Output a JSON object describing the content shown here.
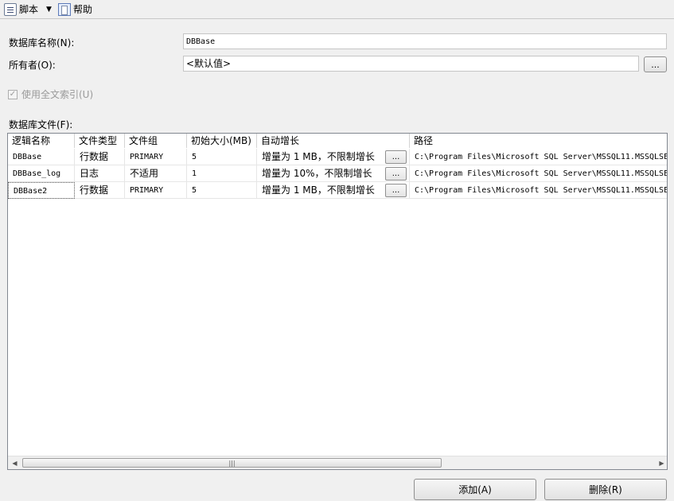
{
  "toolbar": {
    "script": {
      "label": "脚本",
      "icon": "script-icon"
    },
    "help": {
      "label": "帮助",
      "icon": "help-icon"
    }
  },
  "form": {
    "database_name_label": "数据库名称(N):",
    "database_name_value": "DBBase",
    "owner_label": "所有者(O):",
    "owner_value": "<默认值>",
    "fulltext_label": "使用全文索引(U)",
    "fulltext_checked": true,
    "files_label": "数据库文件(F):",
    "ellipsis": "..."
  },
  "grid": {
    "headers": [
      "逻辑名称",
      "文件类型",
      "文件组",
      "初始大小(MB)",
      "自动增长",
      "路径"
    ],
    "rows": [
      {
        "logical_name": "DBBase",
        "file_type": "行数据",
        "filegroup": "PRIMARY",
        "initial_size": "5",
        "autogrowth": "增量为 1 MB，不限制增长",
        "path": "C:\\Program Files\\Microsoft SQL Server\\MSSQL11.MSSQLSE"
      },
      {
        "logical_name": "DBBase_log",
        "file_type": "日志",
        "filegroup": "不适用",
        "initial_size": "1",
        "autogrowth": "增量为 10%，不限制增长",
        "path": "C:\\Program Files\\Microsoft SQL Server\\MSSQL11.MSSQLSE"
      },
      {
        "logical_name": "DBBase2",
        "file_type": "行数据",
        "filegroup": "PRIMARY",
        "initial_size": "5",
        "autogrowth": "增量为 1 MB，不限制增长",
        "path": "C:\\Program Files\\Microsoft SQL Server\\MSSQL11.MSSQLSE"
      }
    ],
    "scroll_thumb_grip": "|||"
  },
  "buttons": {
    "add": "添加(A)",
    "remove": "删除(R)"
  }
}
